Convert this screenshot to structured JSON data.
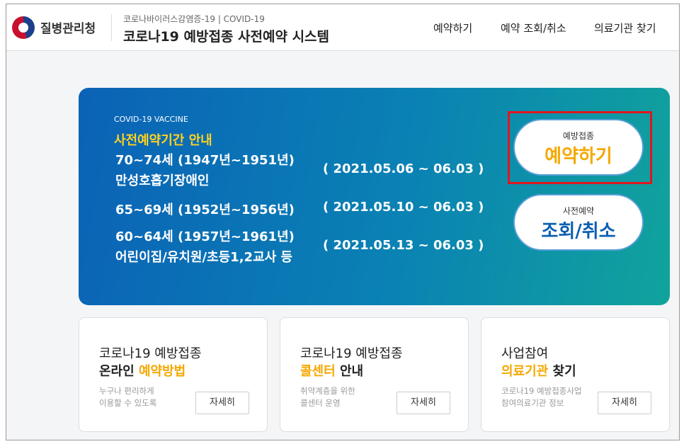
{
  "header": {
    "org": "질병관리청",
    "subtitle": "코로나바이러스감염증-19 | COVID-19",
    "title": "코로나19 예방접종 사전예약 시스템",
    "nav": [
      "예약하기",
      "예약 조회/취소",
      "의료기관 찾기"
    ]
  },
  "banner": {
    "eyebrow": "COVID-19 VACCINE",
    "heading": "사전예약기간 안내",
    "groups": [
      {
        "line1": "70~74세 (1947년~1951년)",
        "line2": "만성호흡기장애인",
        "period": "( 2021.05.06 ~ 06.03 )"
      },
      {
        "line1": "65~69세 (1952년~1956년)",
        "period": "( 2021.05.10 ~ 06.03 )"
      },
      {
        "line1": "60~64세 (1957년~1961년)",
        "line2": "어린이집/유치원/초등1,2교사 등",
        "period": "( 2021.05.13 ~ 06.03 )"
      }
    ],
    "reserve": {
      "small": "예방접종",
      "large": "예약하기"
    },
    "lookup": {
      "small": "사전예약",
      "large": "조회/취소"
    }
  },
  "colors": {
    "accent": "#f5a800",
    "banner_start": "#0b62b6",
    "banner_end": "#11a39c",
    "highlight": "#e0161e"
  },
  "cards": [
    {
      "t1": "코로나19 예방접종",
      "t2a": "온라인 ",
      "t2b": "예약방법",
      "desc1": "누구나 편리하게",
      "desc2": "이용할 수 있도록",
      "btn": "자세히"
    },
    {
      "t1": "코로나19 예방접종",
      "t2b": "콜센터",
      "t2a": " 안내",
      "desc1": "취약계층을 위한",
      "desc2": "콜센터 운영",
      "btn": "자세히"
    },
    {
      "t1": "사업참여",
      "t2b": "의료기관",
      "t2a": " 찾기",
      "desc1": "코로나19 예방접종사업",
      "desc2": "참여의료기관 정보",
      "btn": "자세히"
    }
  ]
}
